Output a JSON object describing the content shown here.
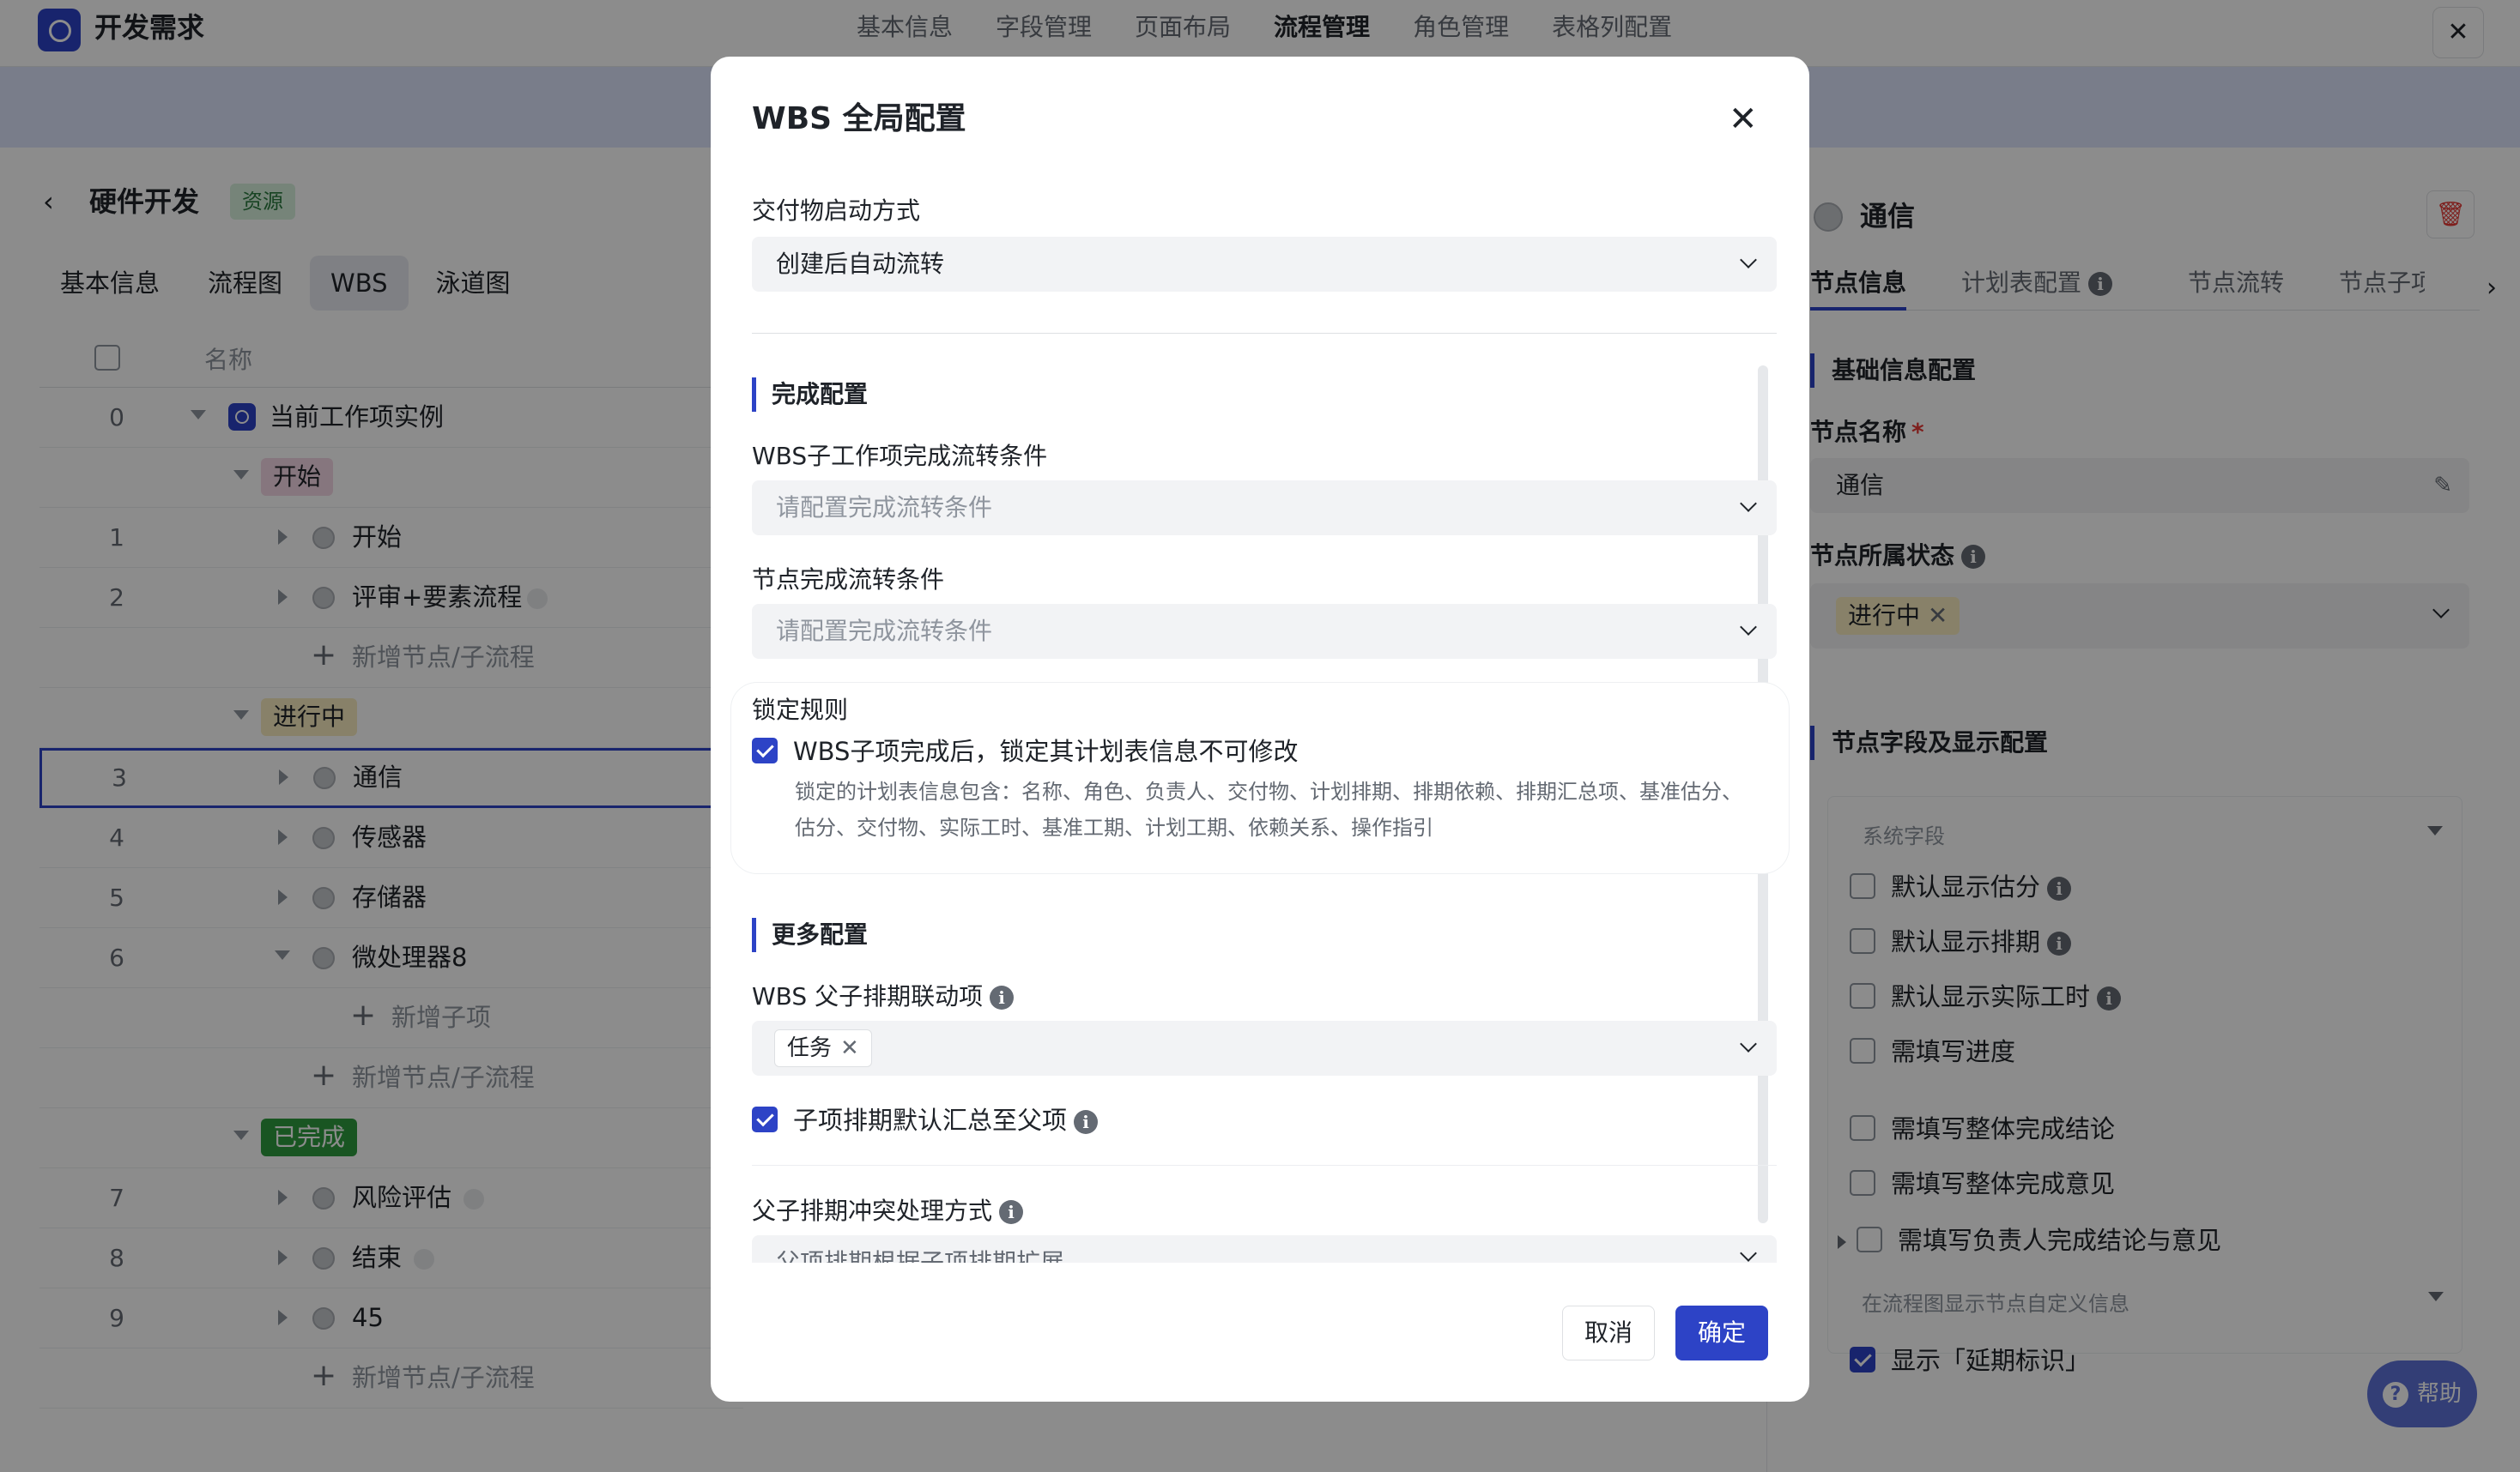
{
  "app": {
    "title": "开发需求",
    "close_icon": "close-icon"
  },
  "nav_tabs": [
    "基本信息",
    "字段管理",
    "页面布局",
    "流程管理",
    "角色管理",
    "表格列配置"
  ],
  "left": {
    "back": "‹",
    "title": "硬件开发",
    "tag": "资源",
    "tabs": [
      "基本信息",
      "流程图",
      "WBS",
      "泳道图"
    ],
    "col_name": "名称",
    "rows": {
      "r0": {
        "num": "0",
        "text": "当前工作项实例"
      },
      "s1": "开始",
      "r1": {
        "num": "1",
        "text": "开始"
      },
      "r2": {
        "num": "2",
        "text": "评审+要素流程"
      },
      "add": "新增节点/子流程",
      "s2": "进行中",
      "r3": {
        "num": "3",
        "text": "通信"
      },
      "r4": {
        "num": "4",
        "text": "传感器"
      },
      "r5": {
        "num": "5",
        "text": "存储器"
      },
      "r6": {
        "num": "6",
        "text": "微处理器8"
      },
      "addsub": "新增子项",
      "s3": "已完成",
      "r7": {
        "num": "7",
        "text": "风险评估"
      },
      "r8": {
        "num": "8",
        "text": "结束"
      },
      "r9": {
        "num": "9",
        "text": "45"
      }
    }
  },
  "right": {
    "title": "通信",
    "tabs": [
      "节点信息",
      "计划表配置",
      "节点流转",
      "节点子项"
    ],
    "sec_basic": "基础信息配置",
    "name_label": "节点名称",
    "required": "*",
    "name_value": "通信",
    "state_label": "节点所属状态",
    "state_value": "进行中",
    "sec_fields": "节点字段及显示配置",
    "sys_group": "系统字段",
    "checks": [
      "默认显示估分",
      "默认显示排期",
      "默认显示实际工时",
      "需填写进度",
      "需填写整体完成结论",
      "需填写整体完成意见",
      "需填写负责人完成结论与意见"
    ],
    "flow_group": "在流程图显示节点自定义信息",
    "flow_check": "显示「延期标识」",
    "help": "帮助"
  },
  "modal": {
    "title": "WBS 全局配置",
    "deliver_label": "交付物启动方式",
    "deliver_value": "创建后自动流转",
    "sec_complete": "完成配置",
    "wbs_cond_label": "WBS子工作项完成流转条件",
    "wbs_cond_ph": "请配置完成流转条件",
    "node_cond_label": "节点完成流转条件",
    "node_cond_ph": "请配置完成流转条件",
    "lock_title": "锁定规则",
    "lock_check": "WBS子项完成后，锁定其计划表信息不可修改",
    "lock_desc": "锁定的计划表信息包含：名称、角色、负责人、交付物、计划排期、排期依赖、排期汇总项、基准估分、估分、交付物、实际工时、基准工期、计划工期、依赖关系、操作指引",
    "sec_more": "更多配置",
    "link_label": "WBS 父子排期联动项",
    "link_chip": "任务",
    "sum_check": "子项排期默认汇总至父项",
    "conflict_label": "父子排期冲突处理方式",
    "conflict_value": "父项排期根据子项排期扩展",
    "cancel": "取消",
    "ok": "确定"
  },
  "colors": {
    "accent": "#2d43c6",
    "stage_done": "#2f9b3f",
    "stage_progress": "#f7ecc0",
    "stage_start": "#f5d8e5"
  }
}
